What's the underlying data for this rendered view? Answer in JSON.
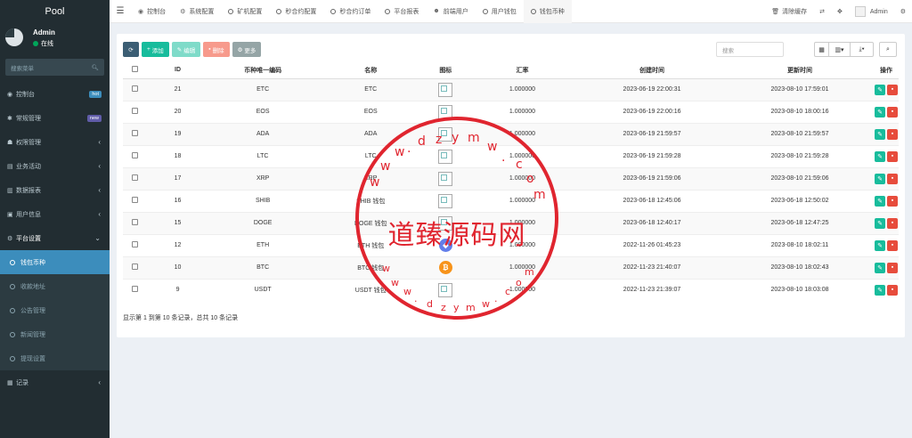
{
  "sidebar": {
    "logo": "Pool",
    "user": {
      "name": "Admin",
      "status": "在线"
    },
    "search_placeholder": "搜索菜单",
    "menu": [
      {
        "label": "控制台",
        "icon": "dashboard-icon",
        "badge": "hot",
        "badge_color": "#3c8dbc"
      },
      {
        "label": "常规管理",
        "icon": "cogs-icon",
        "badge": "new",
        "badge_color": "#605ca8"
      },
      {
        "label": "权限管理",
        "icon": "group-icon",
        "arrow": "‹"
      },
      {
        "label": "业务活动",
        "icon": "list-icon",
        "arrow": "‹"
      },
      {
        "label": "数据报表",
        "icon": "file-icon",
        "arrow": "‹"
      },
      {
        "label": "用户信息",
        "icon": "user-icon",
        "arrow": "‹"
      },
      {
        "label": "平台设置",
        "icon": "gear-icon",
        "arrow": "⌄"
      }
    ],
    "submenu": [
      {
        "label": "钱包币种",
        "active": true
      },
      {
        "label": "收款地址"
      },
      {
        "label": "公告管理"
      },
      {
        "label": "新闻管理"
      },
      {
        "label": "提现设置"
      }
    ],
    "last_menu": {
      "label": "记录",
      "icon": "chart-icon",
      "arrow": "‹"
    }
  },
  "topbar": {
    "tabs": [
      {
        "label": "控制台",
        "icon": "dashboard-icon"
      },
      {
        "label": "系统配置",
        "icon": "cog-icon"
      },
      {
        "label": "矿机配置",
        "icon": "circle-icon"
      },
      {
        "label": "秒合约配置",
        "icon": "circle-icon"
      },
      {
        "label": "秒合约订单",
        "icon": "circle-icon"
      },
      {
        "label": "平台报表",
        "icon": "circle-icon"
      },
      {
        "label": "前端用户",
        "icon": "user-circle-icon"
      },
      {
        "label": "用户钱包",
        "icon": "circle-icon"
      },
      {
        "label": "钱包币种",
        "icon": "circle-icon",
        "active": true
      }
    ],
    "clear_cache": "清除缓存",
    "admin": "Admin"
  },
  "toolbar": {
    "add": "添加",
    "edit": "编辑",
    "delete": "删除",
    "more": "更多",
    "search_placeholder": "搜索"
  },
  "table": {
    "headers": [
      "ID",
      "币种唯一编码",
      "名称",
      "图标",
      "汇率",
      "创建时间",
      "更新时间",
      "操作"
    ],
    "rows": [
      {
        "id": "21",
        "code": "ETC",
        "name": "ETC",
        "icon": "broken",
        "rate": "1.000000",
        "created": "2023-06-19 22:00:31",
        "updated": "2023-08-10 17:59:01"
      },
      {
        "id": "20",
        "code": "EOS",
        "name": "EOS",
        "icon": "broken",
        "rate": "1.000000",
        "created": "2023-06-19 22:00:16",
        "updated": "2023-08-10 18:00:16"
      },
      {
        "id": "19",
        "code": "ADA",
        "name": "ADA",
        "icon": "broken",
        "rate": "1.000000",
        "created": "2023-06-19 21:59:57",
        "updated": "2023-08-10 21:59:57"
      },
      {
        "id": "18",
        "code": "LTC",
        "name": "LTC",
        "icon": "broken",
        "rate": "1.000000",
        "created": "2023-06-19 21:59:28",
        "updated": "2023-08-10 21:59:28"
      },
      {
        "id": "17",
        "code": "XRP",
        "name": "XRP",
        "icon": "broken",
        "rate": "1.000000",
        "created": "2023-06-19 21:59:06",
        "updated": "2023-08-10 21:59:06"
      },
      {
        "id": "16",
        "code": "SHIB",
        "name": "SHIB 钱包",
        "icon": "broken",
        "rate": "1.000000",
        "created": "2023-06-18 12:45:06",
        "updated": "2023-06-18 12:50:02"
      },
      {
        "id": "15",
        "code": "DOGE",
        "name": "DOGE 钱包",
        "icon": "broken",
        "rate": "1.000000",
        "created": "2023-06-18 12:40:17",
        "updated": "2023-06-18 12:47:25"
      },
      {
        "id": "12",
        "code": "ETH",
        "name": "ETH 钱包",
        "icon": "eth",
        "rate": "1.000000",
        "created": "2022-11-26 01:45:23",
        "updated": "2023-08-10 18:02:11"
      },
      {
        "id": "10",
        "code": "BTC",
        "name": "BTC 钱包",
        "icon": "btc",
        "rate": "1.000000",
        "created": "2022-11-23 21:40:07",
        "updated": "2023-08-10 18:02:43"
      },
      {
        "id": "9",
        "code": "USDT",
        "name": "USDT 钱包",
        "icon": "broken",
        "rate": "1.000000",
        "created": "2022-11-23 21:39:07",
        "updated": "2023-08-10 18:03:08"
      }
    ],
    "footer": "显示第 1 到第 10 条记录，总共 10 条记录"
  },
  "watermark": {
    "center_text": "道臻源码网",
    "colors": {
      "stamp": "#e0252f"
    }
  },
  "colors": {
    "sidebar_bg": "#222d32",
    "active_blue": "#3c8dbc",
    "success": "#18bc9c",
    "danger": "#e74c3c"
  }
}
